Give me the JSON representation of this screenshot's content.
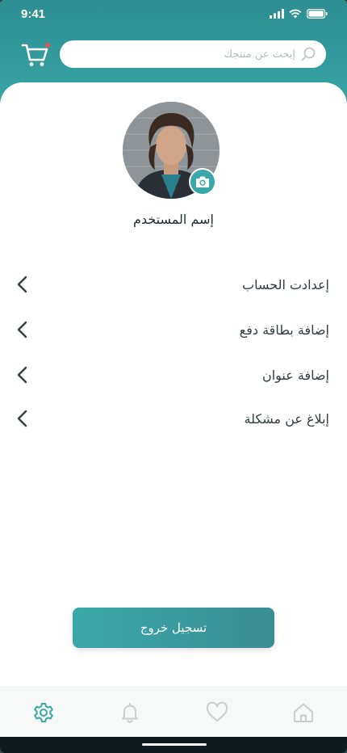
{
  "status_bar": {
    "time": "9:41"
  },
  "header": {
    "search": {
      "placeholder": "إبحث عن منتجك",
      "value": ""
    }
  },
  "profile": {
    "username": "إسم المستخدم"
  },
  "menu": {
    "items": [
      {
        "label": "إعدادت الحساب"
      },
      {
        "label": "إضافة بطاقة دفع"
      },
      {
        "label": "إضافة عنوان"
      },
      {
        "label": "إبلاغ عن مشكلة"
      }
    ]
  },
  "logout": {
    "label": "تسجيل خروج"
  },
  "bottom_nav": {
    "items": [
      "gear-icon",
      "bell-icon",
      "heart-icon",
      "home-icon"
    ],
    "active": "gear-icon"
  },
  "colors": {
    "accent": "#3aa8a8",
    "accent_dark": "#2d8e92",
    "text": "#333c40",
    "nav_inactive": "#c9cece",
    "cart_badge": "#e8554e"
  }
}
